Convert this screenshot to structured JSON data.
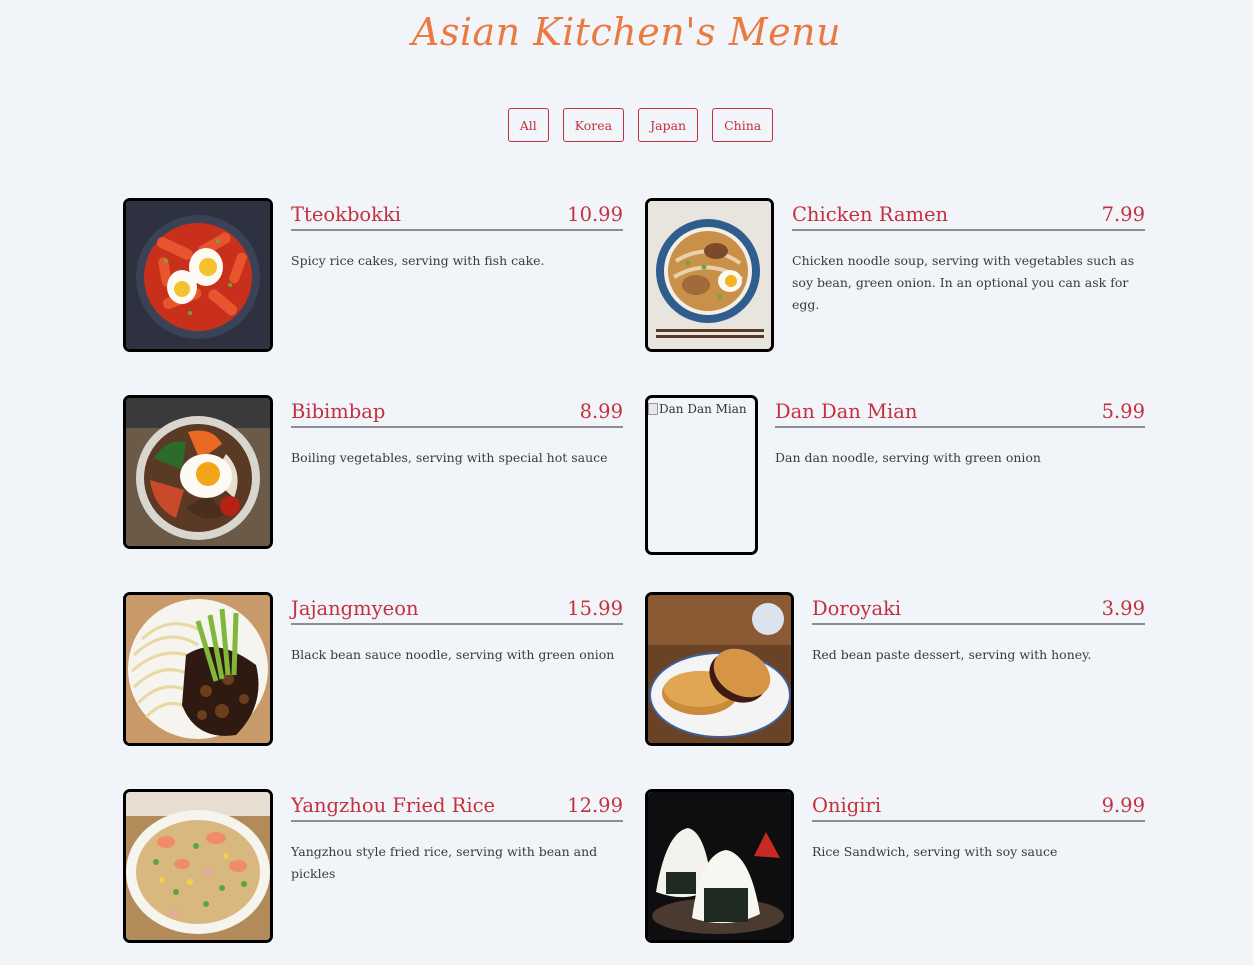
{
  "header": {
    "title": "Asian Kitchen's Menu"
  },
  "filters": [
    "All",
    "Korea",
    "Japan",
    "China"
  ],
  "items": [
    {
      "name": "Tteokbokki",
      "price": "10.99",
      "desc": "Spicy rice cakes, serving with fish cake.",
      "image_icon": "tteokbokki-photo"
    },
    {
      "name": "Chicken Ramen",
      "price": "7.99",
      "desc": "Chicken noodle soup, serving with vegetables such as soy bean, green onion. In an optional you can ask for egg.",
      "image_icon": "chicken-ramen-photo"
    },
    {
      "name": "Bibimbap",
      "price": "8.99",
      "desc": "Boiling vegetables, serving with special hot sauce",
      "image_icon": "bibimbap-photo"
    },
    {
      "name": "Dan Dan Mian",
      "price": "5.99",
      "desc": "Dan dan noodle, serving with green onion",
      "image_alt": "Dan Dan Mian"
    },
    {
      "name": "Jajangmyeon",
      "price": "15.99",
      "desc": "Black bean sauce noodle, serving with green onion",
      "image_icon": "jajangmyeon-photo"
    },
    {
      "name": "Doroyaki",
      "price": "3.99",
      "desc": "Red bean paste dessert, serving with honey.",
      "image_icon": "dorayaki-photo"
    },
    {
      "name": "Yangzhou Fried Rice",
      "price": "12.99",
      "desc": "Yangzhou style fried rice, serving with bean and pickles",
      "image_icon": "fried-rice-photo"
    },
    {
      "name": "Onigiri",
      "price": "9.99",
      "desc": "Rice Sandwich, serving with soy sauce",
      "image_icon": "onigiri-photo"
    }
  ],
  "colors": {
    "background": "#f1f4f8",
    "title": "#ea7a42",
    "accent": "#c3313f",
    "text": "#3a3a3a",
    "divider": "#8e8e8e"
  }
}
